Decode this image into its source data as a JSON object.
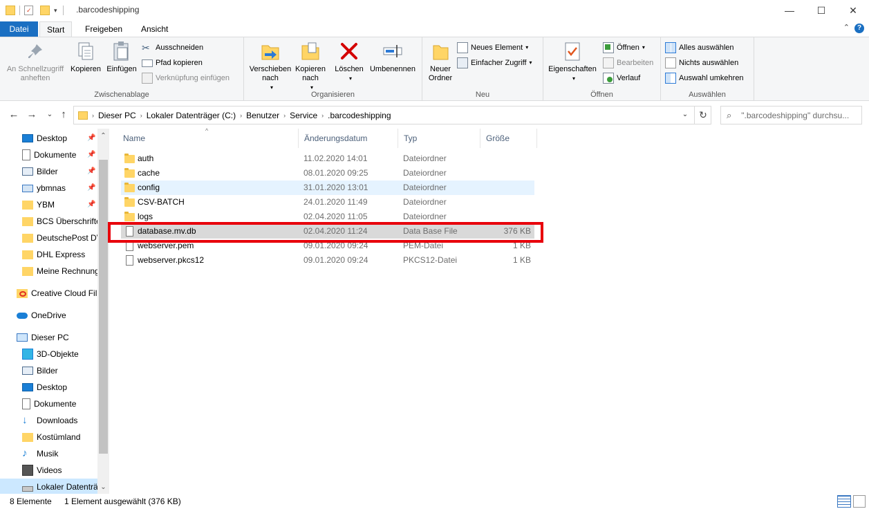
{
  "window": {
    "title": ".barcodeshipping",
    "minimize": "—",
    "maximize": "☐",
    "close": "✕"
  },
  "tabs": {
    "file": "Datei",
    "start": "Start",
    "share": "Freigeben",
    "view": "Ansicht"
  },
  "ribbon": {
    "clipboard": {
      "label": "Zwischenablage",
      "pin": "An Schnellzugriff\nanheften",
      "copy": "Kopieren",
      "paste": "Einfügen",
      "cut": "Ausschneiden",
      "copy_path": "Pfad kopieren",
      "paste_shortcut": "Verknüpfung einfügen"
    },
    "organize": {
      "label": "Organisieren",
      "move_to": "Verschieben\nnach",
      "copy_to": "Kopieren\nnach",
      "delete": "Löschen",
      "rename": "Umbenennen"
    },
    "new": {
      "label": "Neu",
      "new_folder": "Neuer\nOrdner",
      "new_item": "Neues Element",
      "easy_access": "Einfacher Zugriff"
    },
    "open": {
      "label": "Öffnen",
      "properties": "Eigenschaften",
      "open": "Öffnen",
      "edit": "Bearbeiten",
      "history": "Verlauf"
    },
    "select": {
      "label": "Auswählen",
      "select_all": "Alles auswählen",
      "select_none": "Nichts auswählen",
      "invert": "Auswahl umkehren"
    }
  },
  "address": {
    "crumbs": [
      "Dieser PC",
      "Lokaler Datenträger (C:)",
      "Benutzer",
      "Service",
      ".barcodeshipping"
    ],
    "search_placeholder": "\".barcodeshipping\" durchsu..."
  },
  "sidebar": {
    "items": [
      {
        "label": "Desktop",
        "icon": "desktop-icon"
      },
      {
        "label": "Dokumente",
        "icon": "documents-icon"
      },
      {
        "label": "Bilder",
        "icon": "pictures-icon"
      },
      {
        "label": "ybmnas",
        "icon": "network-drive-icon"
      },
      {
        "label": "YBM",
        "icon": "folder-icon"
      },
      {
        "label": "BCS Überschrifte",
        "icon": "folder-icon"
      },
      {
        "label": "DeutschePost DV",
        "icon": "folder-icon"
      },
      {
        "label": "DHL Express",
        "icon": "folder-icon"
      },
      {
        "label": "Meine Rechnung",
        "icon": "folder-icon"
      },
      {
        "label": "Creative Cloud Fil",
        "icon": "creative-cloud-icon"
      },
      {
        "label": "OneDrive",
        "icon": "onedrive-icon"
      },
      {
        "label": "Dieser PC",
        "icon": "pc-icon"
      },
      {
        "label": "3D-Objekte",
        "icon": "3d-objects-icon"
      },
      {
        "label": "Bilder",
        "icon": "pictures-icon"
      },
      {
        "label": "Desktop",
        "icon": "desktop-icon"
      },
      {
        "label": "Dokumente",
        "icon": "documents-icon"
      },
      {
        "label": "Downloads",
        "icon": "downloads-icon"
      },
      {
        "label": "Kostümland",
        "icon": "folder-icon"
      },
      {
        "label": "Musik",
        "icon": "music-icon"
      },
      {
        "label": "Videos",
        "icon": "videos-icon"
      },
      {
        "label": "Lokaler Datenträ",
        "icon": "drive-icon"
      }
    ]
  },
  "columns": {
    "name": "Name",
    "date": "Änderungsdatum",
    "type": "Typ",
    "size": "Größe"
  },
  "files": [
    {
      "name": "auth",
      "date": "11.02.2020 14:01",
      "type": "Dateiordner",
      "size": "",
      "kind": "folder"
    },
    {
      "name": "cache",
      "date": "08.01.2020 09:25",
      "type": "Dateiordner",
      "size": "",
      "kind": "folder"
    },
    {
      "name": "config",
      "date": "31.01.2020 13:01",
      "type": "Dateiordner",
      "size": "",
      "kind": "folder"
    },
    {
      "name": "CSV-BATCH",
      "date": "24.01.2020 11:49",
      "type": "Dateiordner",
      "size": "",
      "kind": "folder"
    },
    {
      "name": "logs",
      "date": "02.04.2020 11:05",
      "type": "Dateiordner",
      "size": "",
      "kind": "folder"
    },
    {
      "name": "database.mv.db",
      "date": "02.04.2020 11:24",
      "type": "Data Base File",
      "size": "376 KB",
      "kind": "file"
    },
    {
      "name": "webserver.pem",
      "date": "09.01.2020 09:24",
      "type": "PEM-Datei",
      "size": "1 KB",
      "kind": "file"
    },
    {
      "name": "webserver.pkcs12",
      "date": "09.01.2020 09:24",
      "type": "PKCS12-Datei",
      "size": "1 KB",
      "kind": "file"
    }
  ],
  "status": {
    "count": "8 Elemente",
    "selection": "1 Element ausgewählt (376 KB)"
  },
  "colors": {
    "accent": "#1a6fc2",
    "highlight_box": "#e8000b",
    "selected_row": "#d9d9d9",
    "hover_row": "#e5f3ff",
    "folder": "#ffd566"
  }
}
